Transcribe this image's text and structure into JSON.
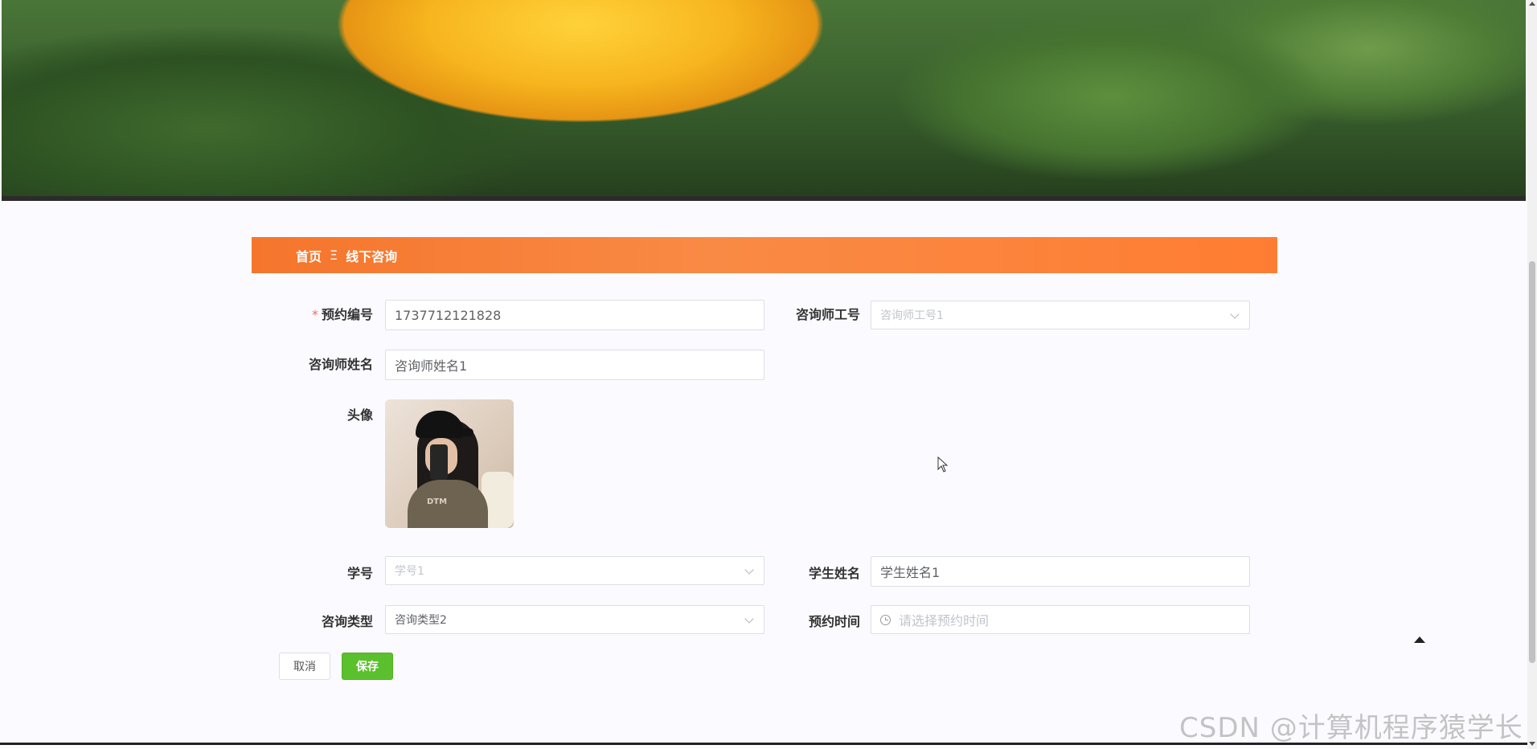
{
  "breadcrumb": {
    "home": "首页",
    "separator": "Ξ",
    "current": "线下咨询"
  },
  "form": {
    "appointment_no": {
      "label": "预约编号",
      "value": "1737712121828",
      "required_mark": "*"
    },
    "counselor_id": {
      "label": "咨询师工号",
      "placeholder": "咨询师工号1"
    },
    "counselor_name": {
      "label": "咨询师姓名",
      "value": "咨询师姓名1"
    },
    "avatar": {
      "label": "头像",
      "image_text": "DTM"
    },
    "student_no": {
      "label": "学号",
      "placeholder": "学号1"
    },
    "student_name": {
      "label": "学生姓名",
      "value": "学生姓名1"
    },
    "consult_type": {
      "label": "咨询类型",
      "value": "咨询类型2"
    },
    "appointment_time": {
      "label": "预约时间",
      "placeholder": "请选择预约时间"
    }
  },
  "buttons": {
    "cancel": "取消",
    "save": "保存"
  },
  "watermark": "CSDN @计算机程序猿学长",
  "colors": {
    "breadcrumb_bg": "#f5752c",
    "save_bg": "#5bc02d",
    "required": "#f56c6c"
  }
}
